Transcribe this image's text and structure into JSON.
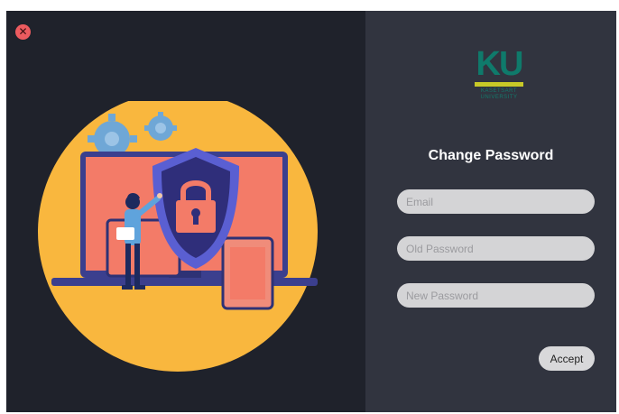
{
  "window": {
    "close_label": "✕"
  },
  "logo": {
    "mark": "KU",
    "line1": "KASETSART",
    "line2": "UNIVERSITY"
  },
  "form": {
    "title": "Change Password",
    "email_placeholder": "Email",
    "old_password_placeholder": "Old Password",
    "new_password_placeholder": "New Password",
    "accept_label": "Accept"
  },
  "icons": {
    "close": "close-icon",
    "illustration": "security-shield-lock-illustration"
  },
  "colors": {
    "left_bg": "#1f222b",
    "right_bg": "#31343f",
    "circle": "#f9b73e",
    "monitor": "#f37b68",
    "shield": "#2f2e7a",
    "close": "#ec5b5f",
    "logo_green": "#0f7a6b",
    "logo_bar": "#c8c928"
  }
}
